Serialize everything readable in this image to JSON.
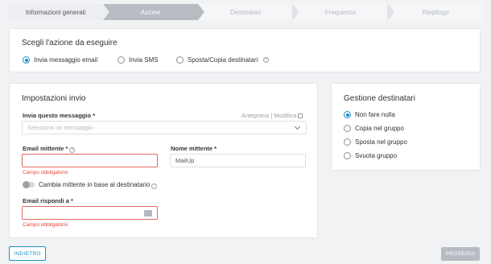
{
  "stepper": {
    "steps": [
      {
        "label": "Informazioni generali",
        "state": "done"
      },
      {
        "label": "Azione",
        "state": "active"
      },
      {
        "label": "Destinatari",
        "state": "pending"
      },
      {
        "label": "Frequenza",
        "state": "pending"
      },
      {
        "label": "Riepilogo",
        "state": "pending"
      }
    ]
  },
  "action_card": {
    "title": "Scegli l'azione da eseguire",
    "options": [
      {
        "label": "Invia messaggio email",
        "selected": true
      },
      {
        "label": "Invia SMS",
        "selected": false
      },
      {
        "label": "Sposta/Copia destinatari",
        "selected": false
      }
    ]
  },
  "send_settings": {
    "title": "Impostazioni invio",
    "message_label": "Invia questo messaggio *",
    "preview_link": "Anteprima",
    "separator": "|",
    "edit_link": "Modifica",
    "message_placeholder": "Seleziona un messaggio",
    "sender_email_label": "Email mittente *",
    "sender_email_value": "",
    "sender_email_error": "Campo obbligatorio",
    "sender_name_label": "Nome mittente *",
    "sender_name_value": "MailUp",
    "toggle_label": "Cambia mittente in base al destinatario",
    "reply_to_label": "Email rispondi a *",
    "reply_to_value": "",
    "reply_to_error": "Campo obbligatorio"
  },
  "recipients_card": {
    "title": "Gestione destinatari",
    "options": [
      {
        "label": "Non fare nulla",
        "selected": true
      },
      {
        "label": "Copia nel gruppo",
        "selected": false
      },
      {
        "label": "Sposta nel gruppo",
        "selected": false
      },
      {
        "label": "Svuota gruppo",
        "selected": false
      }
    ]
  },
  "footer": {
    "back_label": "INDIETRO",
    "next_label": "PROSEGUI"
  },
  "colors": {
    "accent": "#1e8ec7",
    "error": "#e0473a",
    "disabled": "#b7bcc3"
  }
}
